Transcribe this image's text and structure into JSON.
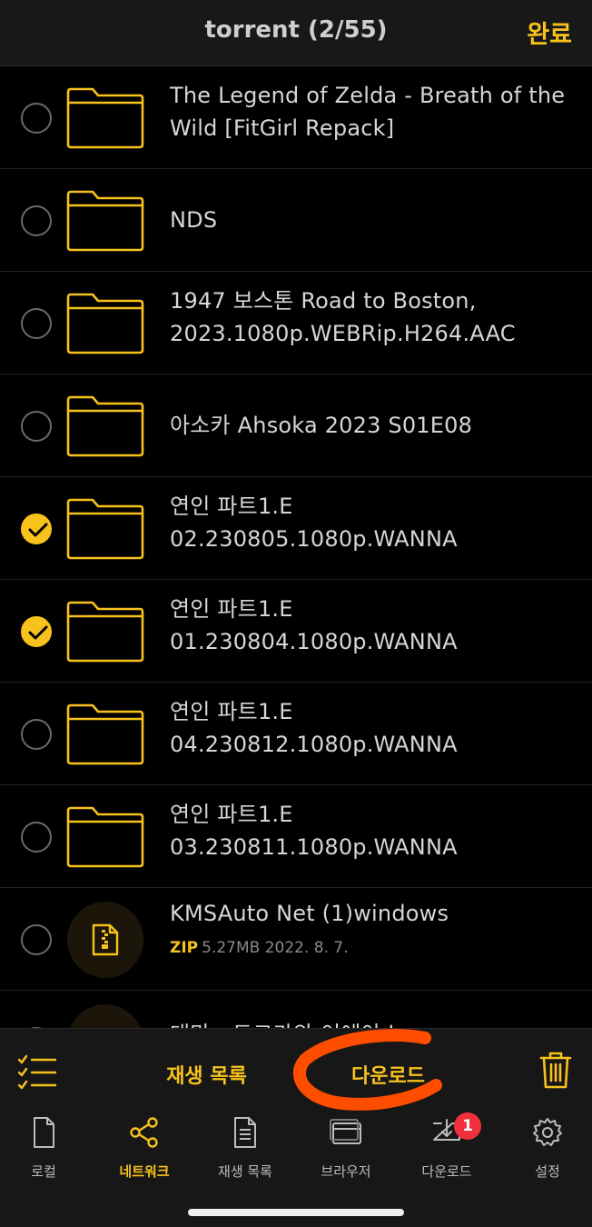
{
  "header": {
    "title": "torrent (2/55)",
    "done_label": "완료"
  },
  "files": [
    {
      "name": "The Legend of Zelda - Breath of the Wild [FitGirl Repack]",
      "checked": false,
      "kind": "folder"
    },
    {
      "name": "NDS",
      "checked": false,
      "kind": "folder"
    },
    {
      "name": "1947 보스톤 Road to Boston, 2023.1080p.WEBRip.H264.AAC",
      "checked": false,
      "kind": "folder"
    },
    {
      "name": "아소카 Ahsoka 2023 S01E08",
      "checked": false,
      "kind": "folder"
    },
    {
      "name": "연인 파트1.E 02.230805.1080p.WANNA",
      "checked": true,
      "kind": "folder"
    },
    {
      "name": "연인 파트1.E 01.230804.1080p.WANNA",
      "checked": true,
      "kind": "folder"
    },
    {
      "name": "연인 파트1.E 04.230812.1080p.WANNA",
      "checked": false,
      "kind": "folder"
    },
    {
      "name": "연인 파트1.E 03.230811.1080p.WANNA",
      "checked": false,
      "kind": "folder"
    },
    {
      "name": "KMSAuto Net (1)windows",
      "checked": false,
      "kind": "zip",
      "ext": "ZIP",
      "size": "5.27MB",
      "date": "2022. 8. 7."
    }
  ],
  "partial_row": {
    "name": "대만 - 도쿄가와 이에야스"
  },
  "toolbar": {
    "select_list_icon": "checklist-icon",
    "playlist_label": "재생 목록",
    "download_label": "다운로드",
    "trash_icon": "trash-icon"
  },
  "tabs": [
    {
      "label": "로컬",
      "icon": "document-icon",
      "active": false
    },
    {
      "label": "네트워크",
      "icon": "share-icon",
      "active": true
    },
    {
      "label": "재생 목록",
      "icon": "list-document-icon",
      "active": false
    },
    {
      "label": "브라우저",
      "icon": "browser-icon",
      "active": false
    },
    {
      "label": "다운로드",
      "icon": "download-tray-icon",
      "active": false,
      "badge": "1"
    },
    {
      "label": "설정",
      "icon": "gear-icon",
      "active": false
    }
  ],
  "colors": {
    "accent": "#f7c21b",
    "badge": "#f0303a",
    "annotation": "#ff4d00"
  }
}
